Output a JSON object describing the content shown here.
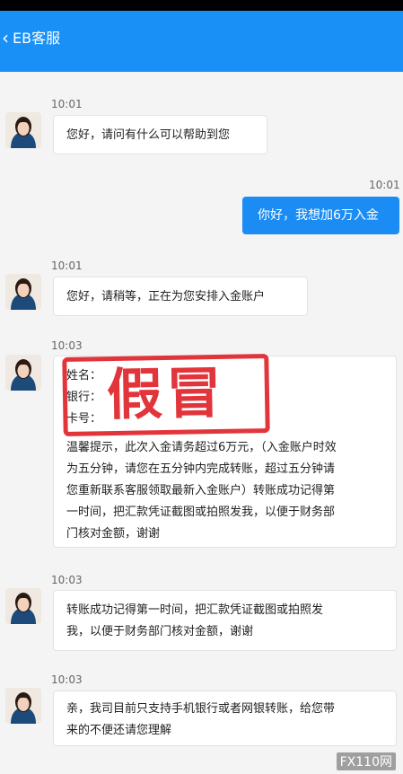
{
  "header": {
    "back_icon": "chevron-left-icon",
    "title": "EB客服"
  },
  "messages": [
    {
      "time": "10:01",
      "side": "left",
      "text": "您好，请问有什么可以帮助到您"
    },
    {
      "time": "10:01",
      "side": "right",
      "text": "你好，我想加6万入金"
    },
    {
      "time": "10:01",
      "side": "left",
      "text": "您好，请稍等，正在为您安排入金账户"
    },
    {
      "time": "10:03",
      "side": "left",
      "lines": [
        "姓名：",
        "银行：",
        "卡号：",
        "温馨提示，此次入金请务超过6万元，（入金账户时效",
        "为五分钟，请您在五分钟内完成转账，超过五分钟请",
        "您重新联系客服领取最新入金账户）转账成功记得第",
        "一时间，把汇款凭证截图或拍照发我，以便于财务部",
        "门核对金额，谢谢"
      ]
    },
    {
      "time": "10:03",
      "side": "left",
      "lines": [
        "转账成功记得第一时间，把汇款凭证截图或拍照发",
        "我，以便于财务部门核对金额，谢谢"
      ]
    },
    {
      "time": "10:03",
      "side": "left",
      "lines": [
        "亲，我司目前只支持手机银行或者网银转账，给您带",
        "来的不便还请您理解"
      ]
    }
  ],
  "stamp_text": "假冒",
  "watermark": "FX110网",
  "colors": {
    "header": "#1990f6",
    "right_bubble": "#1a8cf4",
    "stamp": "#e0242b"
  }
}
